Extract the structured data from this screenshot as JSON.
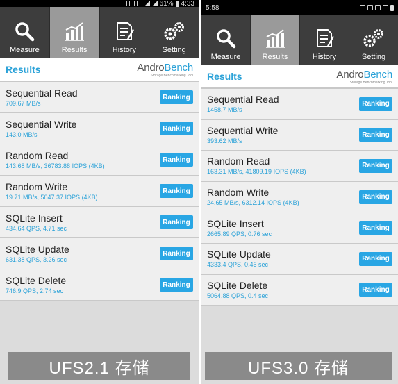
{
  "left": {
    "status": {
      "time": "",
      "battery": "61%",
      "clock": "4:33"
    },
    "tabs": [
      {
        "label": "Measure",
        "icon": "magnifier-icon"
      },
      {
        "label": "Results",
        "icon": "bar-chart-icon"
      },
      {
        "label": "History",
        "icon": "document-icon"
      },
      {
        "label": "Setting",
        "icon": "gears-icon"
      }
    ],
    "results_title": "Results",
    "brand": {
      "andro": "Andro",
      "bench": "Bench",
      "sub": "Storage Benchmarking Tool"
    },
    "rows": [
      {
        "title": "Sequential Read",
        "value": "709.67 MB/s",
        "button": "Ranking"
      },
      {
        "title": "Sequential Write",
        "value": "143.0 MB/s",
        "button": "Ranking"
      },
      {
        "title": "Random Read",
        "value": "143.68 MB/s, 36783.88 IOPS (4KB)",
        "button": "Ranking"
      },
      {
        "title": "Random Write",
        "value": "19.71 MB/s, 5047.37 IOPS (4KB)",
        "button": "Ranking"
      },
      {
        "title": "SQLite Insert",
        "value": "434.64 QPS, 4.71 sec",
        "button": "Ranking"
      },
      {
        "title": "SQLite Update",
        "value": "631.38 QPS, 3.26 sec",
        "button": "Ranking"
      },
      {
        "title": "SQLite Delete",
        "value": "746.9 QPS, 2.74 sec",
        "button": "Ranking"
      }
    ],
    "caption": "UFS2.1 存储"
  },
  "right": {
    "status": {
      "time": "5:58"
    },
    "tabs": [
      {
        "label": "Measure",
        "icon": "magnifier-icon"
      },
      {
        "label": "Results",
        "icon": "bar-chart-icon"
      },
      {
        "label": "History",
        "icon": "document-icon"
      },
      {
        "label": "Setting",
        "icon": "gears-icon"
      }
    ],
    "results_title": "Results",
    "brand": {
      "andro": "Andro",
      "bench": "Bench",
      "sub": "Storage Benchmarking Tool"
    },
    "rows": [
      {
        "title": "Sequential Read",
        "value": "1458.7 MB/s",
        "button": "Ranking"
      },
      {
        "title": "Sequential Write",
        "value": "393.62 MB/s",
        "button": "Ranking"
      },
      {
        "title": "Random Read",
        "value": "163.31 MB/s, 41809.19 IOPS (4KB)",
        "button": "Ranking"
      },
      {
        "title": "Random Write",
        "value": "24.65 MB/s, 6312.14 IOPS (4KB)",
        "button": "Ranking"
      },
      {
        "title": "SQLite Insert",
        "value": "2665.89 QPS, 0.76 sec",
        "button": "Ranking"
      },
      {
        "title": "SQLite Update",
        "value": "4333.4 QPS, 0.46 sec",
        "button": "Ranking"
      },
      {
        "title": "SQLite Delete",
        "value": "5064.88 QPS, 0.4 sec",
        "button": "Ranking"
      }
    ],
    "caption": "UFS3.0 存储"
  },
  "colors": {
    "accent": "#2ba2d8",
    "button": "#29a6e4",
    "tabbar": "#3d3d3d",
    "tab_active": "#9a9a9a",
    "caption_bg": "#8a8a8a"
  }
}
